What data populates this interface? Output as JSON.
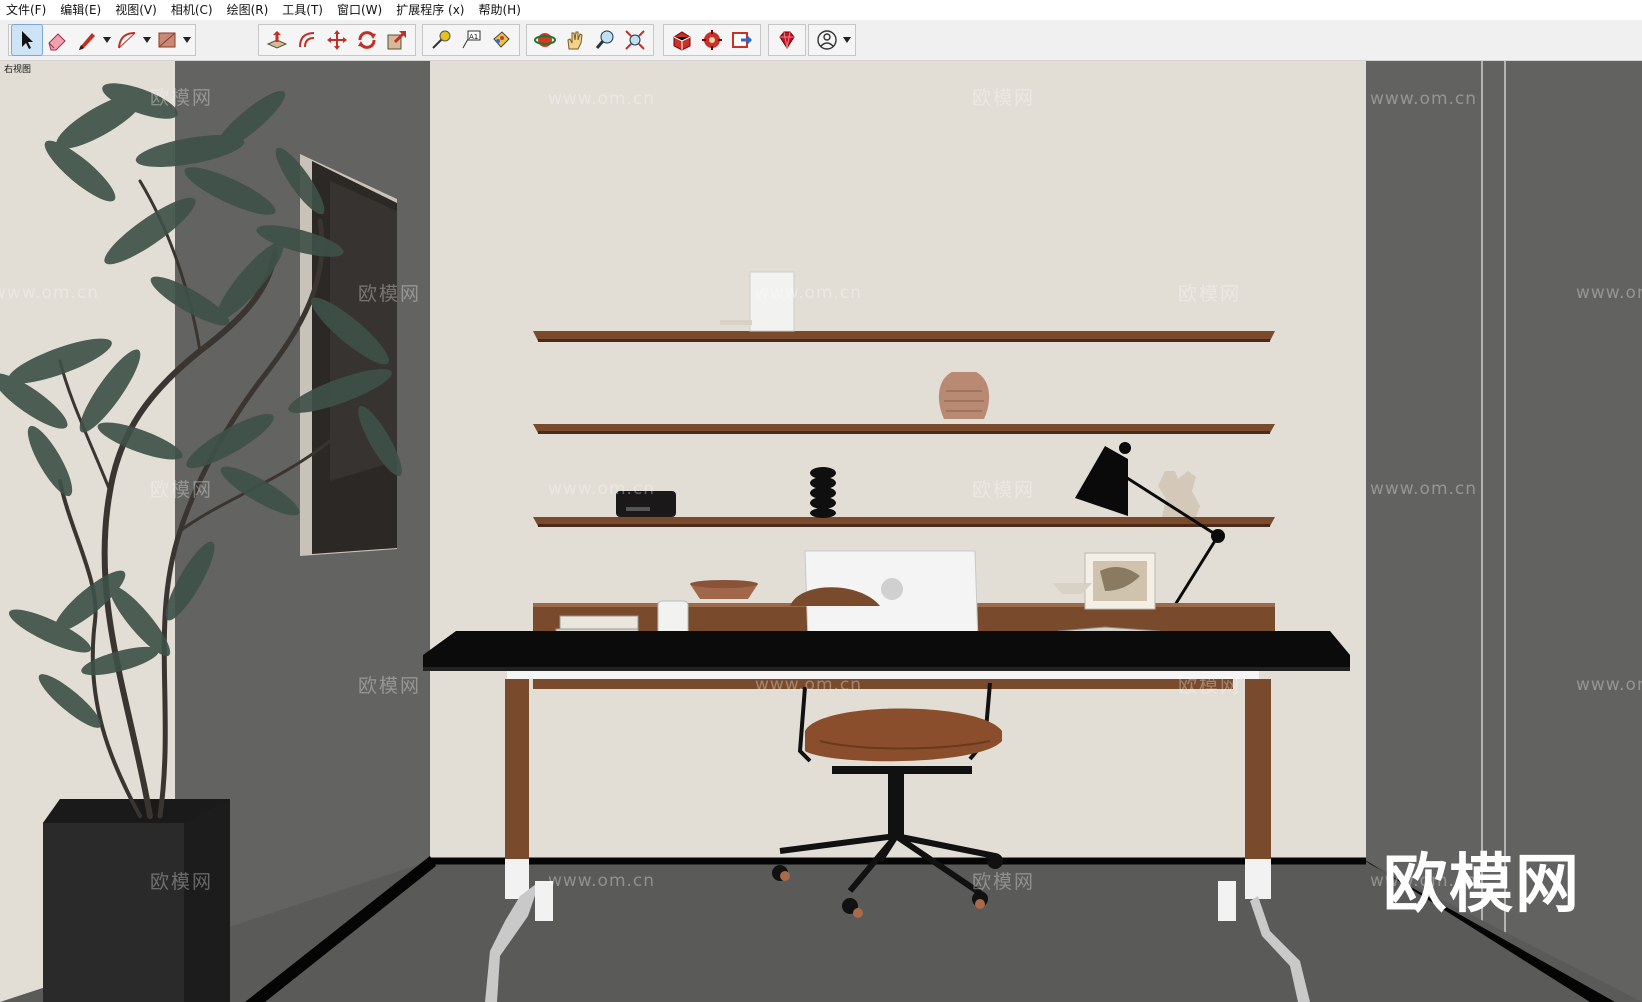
{
  "menu": [
    "文件(F)",
    "编辑(E)",
    "视图(V)",
    "相机(C)",
    "绘图(R)",
    "工具(T)",
    "窗口(W)",
    "扩展程序 (x)",
    "帮助(H)"
  ],
  "toolbar": {
    "groups": [
      [
        "select-icon",
        "eraser-icon",
        "pencil-icon",
        "arc-icon",
        "rectangle-icon"
      ],
      [
        "push-pull-icon",
        "offset-icon",
        "move-icon",
        "rotate-icon",
        "scale-icon"
      ],
      [
        "tape-measure-icon",
        "text-icon",
        "paint-bucket-icon"
      ],
      [
        "orbit-icon",
        "pan-icon",
        "zoom-icon",
        "zoom-extents-icon"
      ],
      [
        "warehouse-icon",
        "extension-warehouse-icon",
        "send-to-layout-icon"
      ],
      [
        "ruby-icon"
      ],
      [
        "account-icon"
      ]
    ]
  },
  "scene": {
    "label": "右视图",
    "watermark_text": "欧模网",
    "watermark_url": "www.om.cn",
    "watermark_big": "欧模网"
  },
  "colors": {
    "wall": "#e2ded6",
    "side_wall": "#626260",
    "floor": "#5e5e5c",
    "shelf_wood": "#7a4a2c",
    "desk_top": "#0b0b0b",
    "chair_leather": "#8a4e2c",
    "active_tool": "#cfe3f7"
  }
}
